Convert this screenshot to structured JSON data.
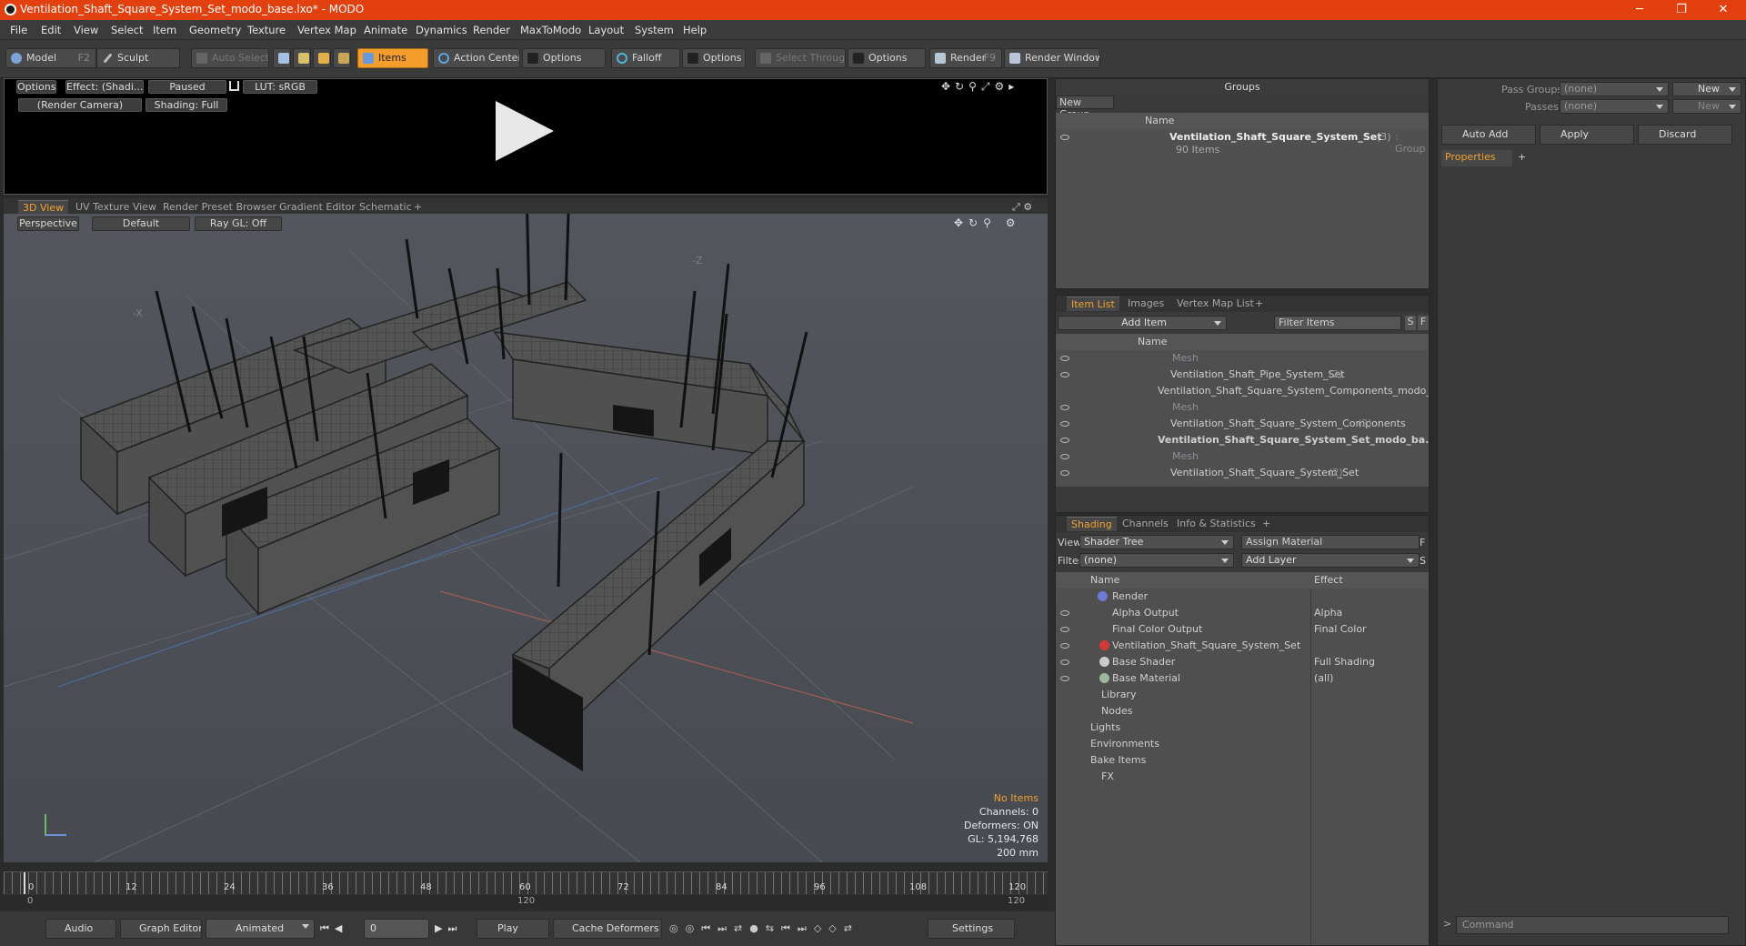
{
  "window": {
    "title": "Ventilation_Shaft_Square_System_Set_modo_base.lxo* - MODO",
    "minimize": "─",
    "maximize": "❐",
    "close": "✕"
  },
  "menu": [
    "File",
    "Edit",
    "View",
    "Select",
    "Item",
    "Geometry",
    "Texture",
    "Vertex Map",
    "Animate",
    "Dynamics",
    "Render",
    "MaxToModo",
    "Layout",
    "System",
    "Help"
  ],
  "toolbar": {
    "model": "Model",
    "model_key": "F2",
    "sculpt": "Sculpt",
    "auto_select": "Auto Select",
    "items": "Items",
    "action_center": "Action Center",
    "options1": "Options",
    "falloff": "Falloff",
    "options2": "Options",
    "select_through": "Select Through",
    "options3": "Options",
    "render": "Render",
    "render_key": "F9",
    "render_window": "Render Window"
  },
  "preview": {
    "options": "Options",
    "effect": "Effect: (Shadi...",
    "paused": "Paused",
    "lut": "LUT: sRGB",
    "camera": "(Render Camera)",
    "shading": "Shading: Full"
  },
  "view_tabs": [
    "3D View",
    "UV Texture View",
    "Render Preset Browser",
    "Gradient Editor",
    "Schematic",
    "+"
  ],
  "viewport": {
    "perspective": "Perspective",
    "default": "Default",
    "raygl": "Ray GL: Off",
    "no_items": "No Items",
    "channels": "Channels: 0",
    "deformers": "Deformers: ON",
    "gl": "GL: 5,194,768",
    "scale": "200 mm",
    "axis_x": "-X",
    "axis_z": "-Z"
  },
  "timeline": {
    "ticks": [
      "0",
      "12",
      "24",
      "36",
      "48",
      "60",
      "72",
      "84",
      "96",
      "108",
      "120"
    ],
    "lower_left": "0",
    "lower_mid": "120",
    "lower_right": "120"
  },
  "bottom": {
    "audio": "Audio",
    "graph_editor": "Graph Editor",
    "animated": "Animated",
    "frame": "0",
    "play": "Play",
    "cache": "Cache Deformers",
    "settings": "Settings"
  },
  "groups": {
    "header": "Groups",
    "new_group": "New Group",
    "col_name": "Name",
    "item_name": "Ventilation_Shaft_Square_System_Set",
    "item_count": "(3)",
    "item_type": ": Group",
    "item_sub": "90 Items"
  },
  "passes": {
    "pass_groups_label": "Pass Groups",
    "pass_groups_value": "(none)",
    "new": "New",
    "passes_label": "Passes",
    "passes_value": "(none)",
    "new2": "New",
    "auto_add": "Auto Add",
    "apply": "Apply",
    "discard": "Discard",
    "properties_tab": "Properties",
    "plus": "+"
  },
  "itemlist": {
    "tabs": [
      "Item List",
      "Images",
      "Vertex Map List",
      "+"
    ],
    "add_item": "Add Item",
    "filter_items": "Filter Items",
    "s": "S",
    "f": "F",
    "col_name": "Name",
    "rows": [
      {
        "label": "Mesh",
        "count": "",
        "grey": true,
        "bold": false
      },
      {
        "label": "Ventilation_Shaft_Pipe_System_Set",
        "count": "(2)",
        "grey": false,
        "bold": false
      },
      {
        "label": "Ventilation_Shaft_Square_System_Components_modo_bas...",
        "count": "",
        "grey": false,
        "bold": false
      },
      {
        "label": "Mesh",
        "count": "",
        "grey": true,
        "bold": false
      },
      {
        "label": "Ventilation_Shaft_Square_System_Components",
        "count": "(2)",
        "grey": false,
        "bold": false
      },
      {
        "label": "Ventilation_Shaft_Square_System_Set_modo_ba...",
        "count": "",
        "grey": false,
        "bold": true
      },
      {
        "label": "Mesh",
        "count": "",
        "grey": true,
        "bold": false
      },
      {
        "label": "Ventilation_Shaft_Square_System_Set",
        "count": "(2)",
        "grey": false,
        "bold": false
      }
    ]
  },
  "shading": {
    "tabs": [
      "Shading",
      "Channels",
      "Info & Statistics",
      "+"
    ],
    "view_label": "View",
    "view_value": "Shader Tree",
    "assign_material": "Assign Material",
    "f": "F",
    "filter_label": "Filter",
    "filter_value": "(none)",
    "add_layer": "Add Layer",
    "s": "S",
    "col_name": "Name",
    "col_effect": "Effect",
    "rows": [
      {
        "name": "Render",
        "effect": ""
      },
      {
        "name": "Alpha Output",
        "effect": "Alpha"
      },
      {
        "name": "Final Color Output",
        "effect": "Final Color"
      },
      {
        "name": "Ventilation_Shaft_Square_System_Set",
        "effect": ""
      },
      {
        "name": "Base Shader",
        "effect": "Full Shading"
      },
      {
        "name": "Base Material",
        "effect": "(all)"
      },
      {
        "name": "Library",
        "effect": ""
      },
      {
        "name": "Nodes",
        "effect": ""
      },
      {
        "name": "Lights",
        "effect": ""
      },
      {
        "name": "Environments",
        "effect": ""
      },
      {
        "name": "Bake Items",
        "effect": ""
      },
      {
        "name": "FX",
        "effect": ""
      }
    ]
  },
  "command": {
    "placeholder": "Command",
    "arrow": ">"
  }
}
